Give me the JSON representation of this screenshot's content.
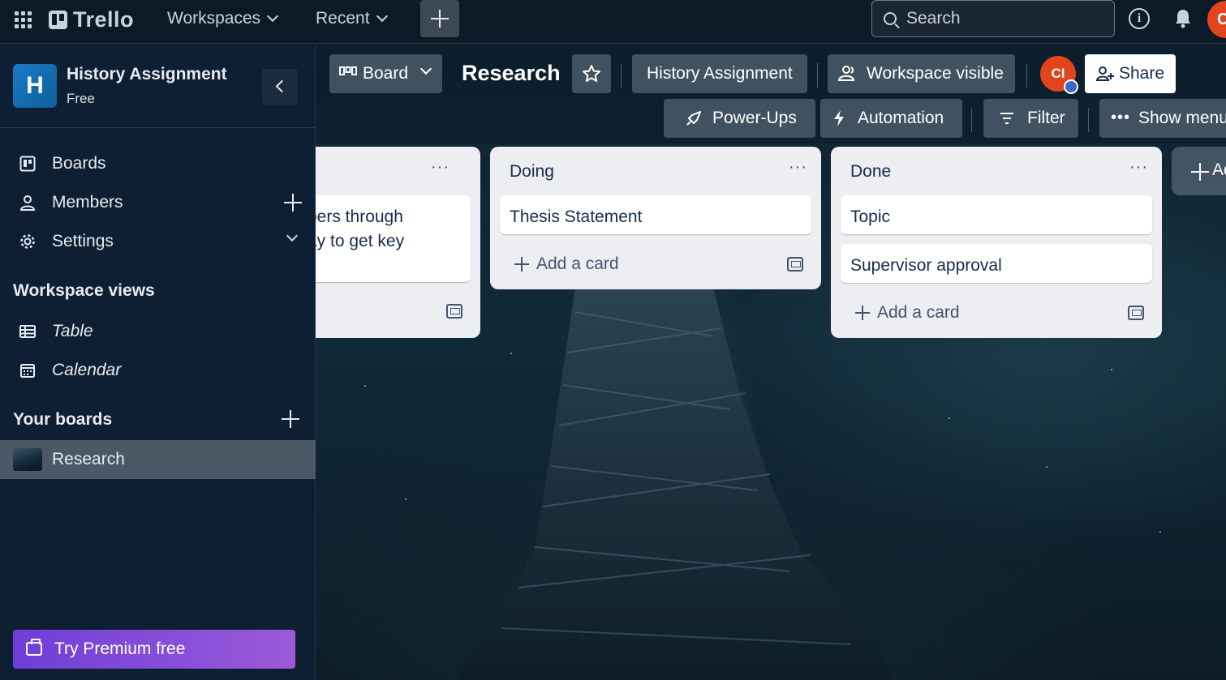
{
  "topnav": {
    "brand": "Trello",
    "workspaces_label": "Workspaces",
    "recent_label": "Recent",
    "search_placeholder": "Search",
    "user_initial": "C"
  },
  "sidebar": {
    "workspace_initial": "H",
    "workspace_name": "History Assignment",
    "workspace_plan": "Free",
    "nav_items": [
      {
        "label": "Boards",
        "icon": "board-icon"
      },
      {
        "label": "Members",
        "icon": "person-icon"
      },
      {
        "label": "Settings",
        "icon": "gear-icon"
      }
    ],
    "views_title": "Workspace views",
    "views": [
      {
        "label": "Table",
        "icon": "table-icon"
      },
      {
        "label": "Calendar",
        "icon": "calendar-icon"
      }
    ],
    "boards_title": "Your boards",
    "boards": [
      {
        "label": "Research"
      }
    ],
    "premium_label": "Try Premium free"
  },
  "board": {
    "view_label": "Board",
    "title": "Research",
    "workspace_chip": "History Assignment",
    "visibility_label": "Workspace visible",
    "member_initials": "CI",
    "share_label": "Share",
    "powerups_label": "Power-Ups",
    "automation_label": "Automation",
    "filter_label": "Filter",
    "show_menu_label": "Show menu",
    "add_list_label": "Ad"
  },
  "lists": [
    {
      "title": "",
      "cards": [
        {
          "text_lines": [
            "bers through",
            "ay to get key"
          ]
        }
      ]
    },
    {
      "title": "Doing",
      "cards": [
        {
          "text": "Thesis Statement"
        }
      ],
      "add_card_label": "Add a card"
    },
    {
      "title": "Done",
      "cards": [
        {
          "text": "Topic"
        },
        {
          "text": "Supervisor approval"
        }
      ],
      "add_card_label": "Add a card"
    }
  ],
  "colors": {
    "nav_bg": "#0c1a28",
    "sidebar_bg": "#0f1f33",
    "list_bg": "#eceef2",
    "avatar_red": "#e3441c",
    "premium_purple": "#6f3ed8"
  }
}
